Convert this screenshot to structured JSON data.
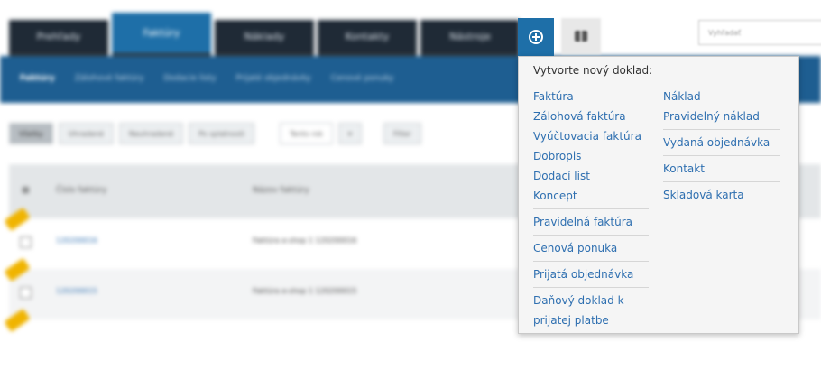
{
  "main_tabs": [
    "Prehľady",
    "Faktúry",
    "Náklady",
    "Kontakty",
    "Nástroje"
  ],
  "sub_nav": [
    "Faktúry",
    "Zálohové faktúry",
    "Dodacie listy",
    "Prijaté objednávky",
    "Cenové ponuky"
  ],
  "filters": [
    "Všetky",
    "Uhradené",
    "Neuhradené",
    "Po splatnosti"
  ],
  "filter_select": "Tento rok",
  "filter_button": "Filter",
  "search": {
    "placeholder": "Vyhľadať"
  },
  "table": {
    "headers": [
      "Číslo faktúry",
      "Názov faktúry"
    ],
    "rows": [
      {
        "number": "120200016",
        "name": "Faktúra e-shop 1 120200016"
      },
      {
        "number": "120200015",
        "name": "Faktúra e-shop 1 120200015"
      }
    ]
  },
  "new_doc_menu": {
    "title": "Vytvorte nový doklad:",
    "left": {
      "group1": [
        "Faktúra",
        "Zálohová faktúra",
        "Vyúčtovacia faktúra",
        "Dobropis",
        "Dodací list",
        "Koncept"
      ],
      "group2": [
        "Pravidelná faktúra"
      ],
      "group3": [
        "Cenová ponuka"
      ],
      "group4": [
        "Prijatá objednávka"
      ],
      "group5": [
        "Daňový doklad k prijatej platbe"
      ]
    },
    "right": {
      "group1": [
        "Náklad",
        "Pravidelný náklad"
      ],
      "group2": [
        "Vydaná objednávka"
      ],
      "group3": [
        "Kontakt"
      ],
      "group4": [
        "Skladová karta"
      ]
    }
  }
}
